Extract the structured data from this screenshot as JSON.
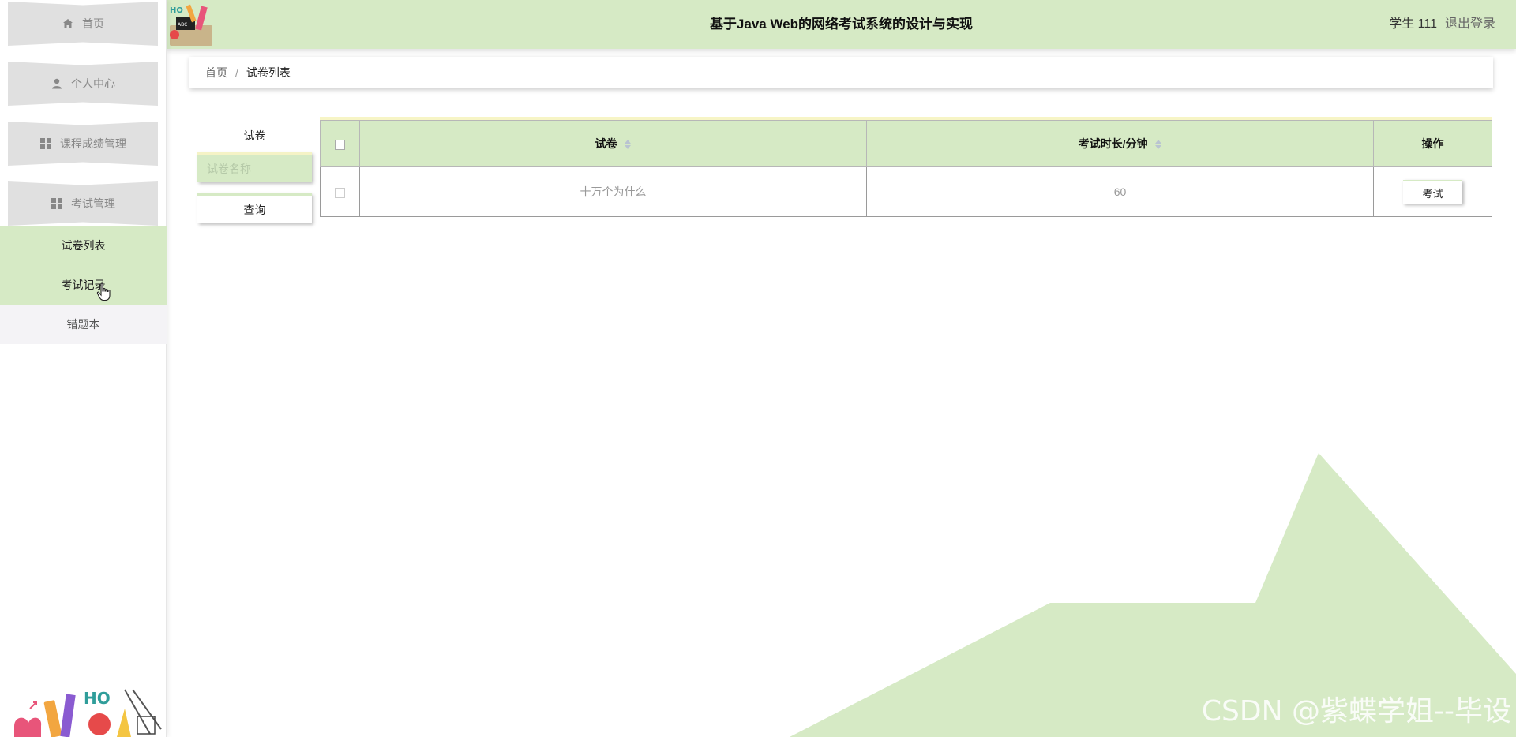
{
  "header": {
    "title": "基于Java Web的网络考试系统的设计与实现",
    "user": "学生 111",
    "logout": "退出登录"
  },
  "sidebar": {
    "items": [
      {
        "label": "首页",
        "icon": "home-icon"
      },
      {
        "label": "个人中心",
        "icon": "user-icon"
      },
      {
        "label": "课程成绩管理",
        "icon": "grid-icon"
      },
      {
        "label": "考试管理",
        "icon": "grid-icon"
      }
    ],
    "subitems": [
      {
        "label": "试卷列表"
      },
      {
        "label": "考试记录"
      },
      {
        "label": "错题本"
      }
    ]
  },
  "breadcrumb": {
    "home": "首页",
    "separator": "/",
    "current": "试卷列表"
  },
  "search": {
    "label": "试卷",
    "placeholder": "试卷名称",
    "button": "查询"
  },
  "table": {
    "columns": [
      "试卷",
      "考试时长/分钟",
      "操作"
    ],
    "rows": [
      {
        "paper": "十万个为什么",
        "duration": "60",
        "action": "考试"
      }
    ]
  },
  "watermark": "CSDN @紫蝶学姐--毕设",
  "colors": {
    "accent": "#d6eac5",
    "highlight": "#f7f5c6",
    "menu": "#e0e0e0"
  }
}
